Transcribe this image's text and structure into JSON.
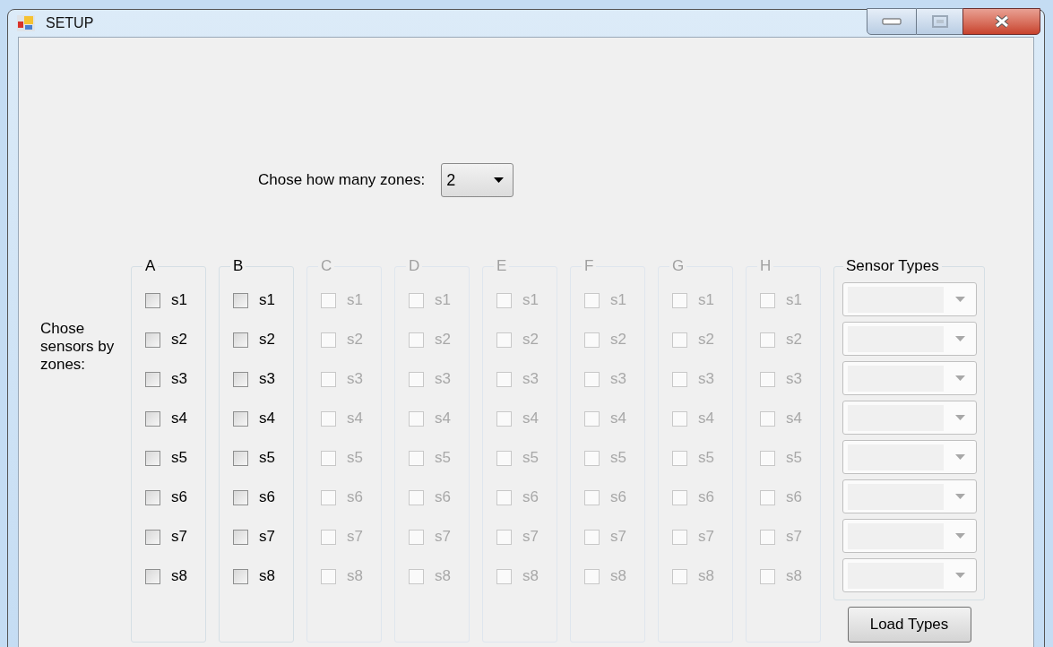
{
  "window": {
    "title": "SETUP"
  },
  "zone_count": {
    "label": "Chose how many zones:",
    "value": "2"
  },
  "sensors_label": "Chose sensors by zones:",
  "zones": [
    {
      "label": "A",
      "disabled": false,
      "sensors": [
        {
          "label": "s1",
          "checked": false
        },
        {
          "label": "s2",
          "checked": false
        },
        {
          "label": "s3",
          "checked": false
        },
        {
          "label": "s4",
          "checked": false
        },
        {
          "label": "s5",
          "checked": false
        },
        {
          "label": "s6",
          "checked": false
        },
        {
          "label": "s7",
          "checked": false
        },
        {
          "label": "s8",
          "checked": false
        }
      ]
    },
    {
      "label": "B",
      "disabled": false,
      "sensors": [
        {
          "label": "s1",
          "checked": false
        },
        {
          "label": "s2",
          "checked": false
        },
        {
          "label": "s3",
          "checked": false
        },
        {
          "label": "s4",
          "checked": false
        },
        {
          "label": "s5",
          "checked": false
        },
        {
          "label": "s6",
          "checked": false
        },
        {
          "label": "s7",
          "checked": false
        },
        {
          "label": "s8",
          "checked": false
        }
      ]
    },
    {
      "label": "C",
      "disabled": true,
      "sensors": [
        {
          "label": "s1",
          "checked": false
        },
        {
          "label": "s2",
          "checked": false
        },
        {
          "label": "s3",
          "checked": false
        },
        {
          "label": "s4",
          "checked": false
        },
        {
          "label": "s5",
          "checked": false
        },
        {
          "label": "s6",
          "checked": false
        },
        {
          "label": "s7",
          "checked": false
        },
        {
          "label": "s8",
          "checked": false
        }
      ]
    },
    {
      "label": "D",
      "disabled": true,
      "sensors": [
        {
          "label": "s1",
          "checked": false
        },
        {
          "label": "s2",
          "checked": false
        },
        {
          "label": "s3",
          "checked": false
        },
        {
          "label": "s4",
          "checked": false
        },
        {
          "label": "s5",
          "checked": false
        },
        {
          "label": "s6",
          "checked": false
        },
        {
          "label": "s7",
          "checked": false
        },
        {
          "label": "s8",
          "checked": false
        }
      ]
    },
    {
      "label": "E",
      "disabled": true,
      "sensors": [
        {
          "label": "s1",
          "checked": false
        },
        {
          "label": "s2",
          "checked": false
        },
        {
          "label": "s3",
          "checked": false
        },
        {
          "label": "s4",
          "checked": false
        },
        {
          "label": "s5",
          "checked": false
        },
        {
          "label": "s6",
          "checked": false
        },
        {
          "label": "s7",
          "checked": false
        },
        {
          "label": "s8",
          "checked": false
        }
      ]
    },
    {
      "label": "F",
      "disabled": true,
      "sensors": [
        {
          "label": "s1",
          "checked": false
        },
        {
          "label": "s2",
          "checked": false
        },
        {
          "label": "s3",
          "checked": false
        },
        {
          "label": "s4",
          "checked": false
        },
        {
          "label": "s5",
          "checked": false
        },
        {
          "label": "s6",
          "checked": false
        },
        {
          "label": "s7",
          "checked": false
        },
        {
          "label": "s8",
          "checked": false
        }
      ]
    },
    {
      "label": "G",
      "disabled": true,
      "sensors": [
        {
          "label": "s1",
          "checked": false
        },
        {
          "label": "s2",
          "checked": false
        },
        {
          "label": "s3",
          "checked": false
        },
        {
          "label": "s4",
          "checked": false
        },
        {
          "label": "s5",
          "checked": false
        },
        {
          "label": "s6",
          "checked": false
        },
        {
          "label": "s7",
          "checked": false
        },
        {
          "label": "s8",
          "checked": false
        }
      ]
    },
    {
      "label": "H",
      "disabled": true,
      "sensors": [
        {
          "label": "s1",
          "checked": false
        },
        {
          "label": "s2",
          "checked": false
        },
        {
          "label": "s3",
          "checked": false
        },
        {
          "label": "s4",
          "checked": false
        },
        {
          "label": "s5",
          "checked": false
        },
        {
          "label": "s6",
          "checked": false
        },
        {
          "label": "s7",
          "checked": false
        },
        {
          "label": "s8",
          "checked": false
        }
      ]
    }
  ],
  "sensor_types": {
    "title": "Sensor Types",
    "dropdowns": [
      {
        "disabled": true
      },
      {
        "disabled": true
      },
      {
        "disabled": true
      },
      {
        "disabled": true
      },
      {
        "disabled": true
      },
      {
        "disabled": true
      },
      {
        "disabled": true
      },
      {
        "disabled": true
      }
    ]
  },
  "load_button": "Load Types"
}
